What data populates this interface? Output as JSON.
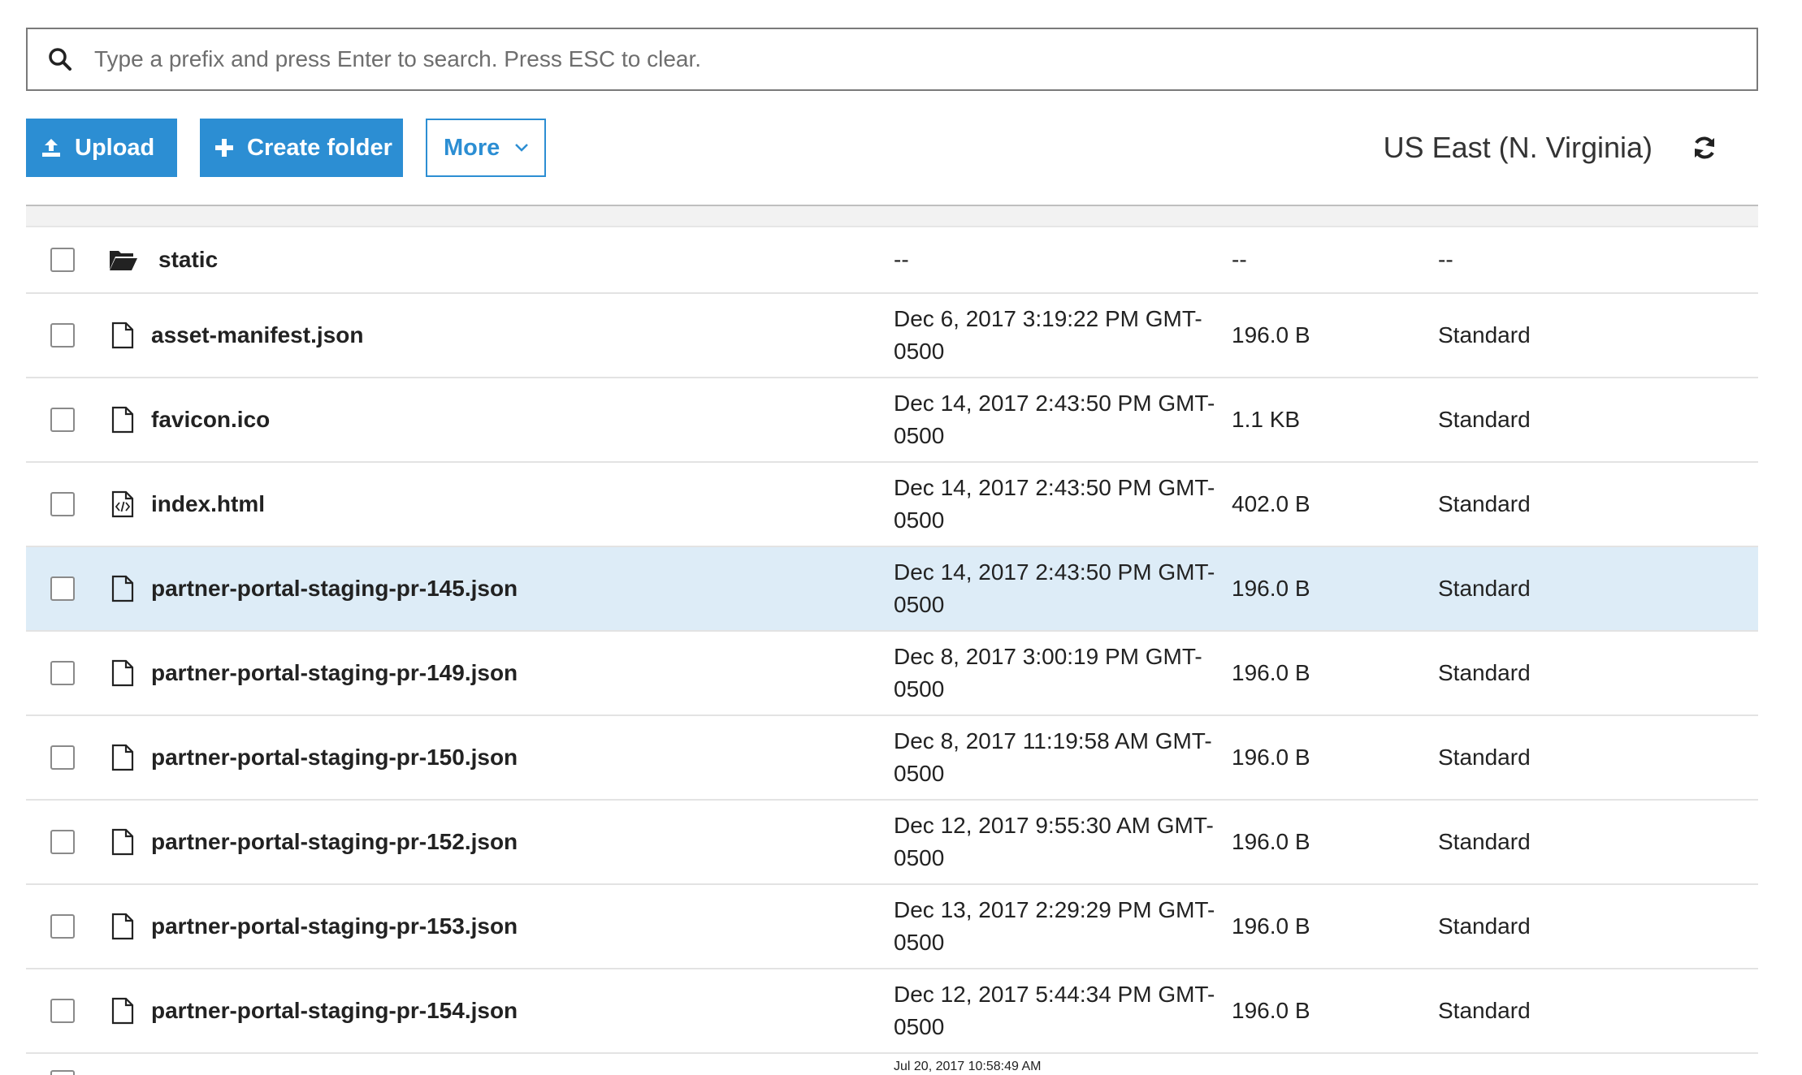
{
  "search": {
    "placeholder": "Type a prefix and press Enter to search. Press ESC to clear."
  },
  "toolbar": {
    "upload_label": "Upload",
    "create_folder_label": "Create folder",
    "more_label": "More",
    "region_label": "US East (N. Virginia)"
  },
  "colors": {
    "accent": "#2c8ed3",
    "selected_row": "#ddecf7"
  },
  "rows": [
    {
      "name": "static",
      "type": "folder",
      "modified": "--",
      "size": "--",
      "storage_class": "--"
    },
    {
      "name": "asset-manifest.json",
      "type": "file",
      "modified": "Dec 6, 2017 3:19:22 PM GMT-0500",
      "size": "196.0 B",
      "storage_class": "Standard"
    },
    {
      "name": "favicon.ico",
      "type": "file",
      "modified": "Dec 14, 2017 2:43:50 PM GMT-0500",
      "size": "1.1 KB",
      "storage_class": "Standard"
    },
    {
      "name": "index.html",
      "type": "code",
      "modified": "Dec 14, 2017 2:43:50 PM GMT-0500",
      "size": "402.0 B",
      "storage_class": "Standard"
    },
    {
      "name": "partner-portal-staging-pr-145.json",
      "type": "file",
      "modified": "Dec 14, 2017 2:43:50 PM GMT-0500",
      "size": "196.0 B",
      "storage_class": "Standard"
    },
    {
      "name": "partner-portal-staging-pr-149.json",
      "type": "file",
      "modified": "Dec 8, 2017 3:00:19 PM GMT-0500",
      "size": "196.0 B",
      "storage_class": "Standard"
    },
    {
      "name": "partner-portal-staging-pr-150.json",
      "type": "file",
      "modified": "Dec 8, 2017 11:19:58 AM GMT-0500",
      "size": "196.0 B",
      "storage_class": "Standard"
    },
    {
      "name": "partner-portal-staging-pr-152.json",
      "type": "file",
      "modified": "Dec 12, 2017 9:55:30 AM GMT-0500",
      "size": "196.0 B",
      "storage_class": "Standard"
    },
    {
      "name": "partner-portal-staging-pr-153.json",
      "type": "file",
      "modified": "Dec 13, 2017 2:29:29 PM GMT-0500",
      "size": "196.0 B",
      "storage_class": "Standard"
    },
    {
      "name": "partner-portal-staging-pr-154.json",
      "type": "file",
      "modified": "Dec 12, 2017 5:44:34 PM GMT-0500",
      "size": "196.0 B",
      "storage_class": "Standard"
    }
  ],
  "partial_row": {
    "modified": "Jul 20, 2017 10:58:49 AM"
  }
}
